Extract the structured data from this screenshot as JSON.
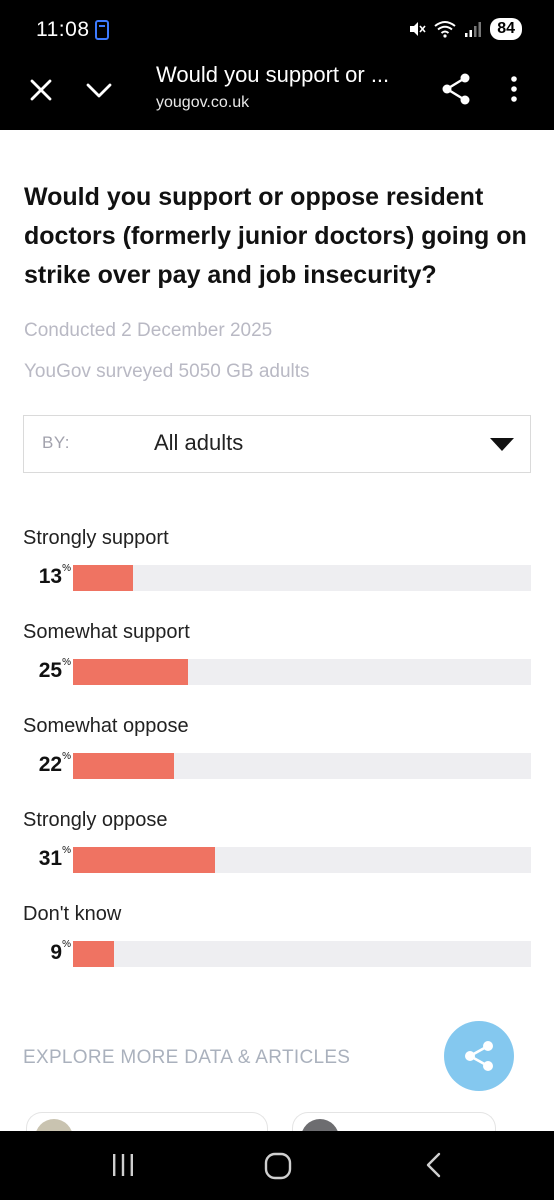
{
  "status_bar": {
    "time": "11:08",
    "battery": "84",
    "icons": [
      "screen-icon",
      "mute-icon",
      "wifi-icon",
      "signal-icon"
    ]
  },
  "app_bar": {
    "title": "Would you support or ...",
    "url": "yougov.co.uk",
    "icons": [
      "close-icon",
      "chevron-down-icon",
      "share-icon",
      "more-vert-icon"
    ]
  },
  "poll": {
    "question": "Would you support or oppose resident doctors (formerly junior doctors) going on strike over pay and job insecurity?",
    "conducted": "Conducted 2 December 2025",
    "surveyed": "YouGov surveyed 5050 GB adults",
    "filter": {
      "label": "BY:",
      "value": "All adults"
    },
    "bar_color": "#ef7362",
    "track_color": "#eeeef1",
    "percent_sign": "%",
    "answers": [
      {
        "label": "Strongly support",
        "value": "13",
        "pct": 13
      },
      {
        "label": "Somewhat support",
        "value": "25",
        "pct": 25
      },
      {
        "label": "Somewhat oppose",
        "value": "22",
        "pct": 22
      },
      {
        "label": "Strongly oppose",
        "value": "31",
        "pct": 31
      },
      {
        "label": "Don't know",
        "value": "9",
        "pct": 9
      }
    ]
  },
  "explore": {
    "heading": "EXPLORE MORE DATA & ARTICLES"
  },
  "fab_color": "#84c8ef",
  "nav_bar": {
    "icons": [
      "recent-apps-icon",
      "home-icon",
      "back-icon"
    ]
  }
}
